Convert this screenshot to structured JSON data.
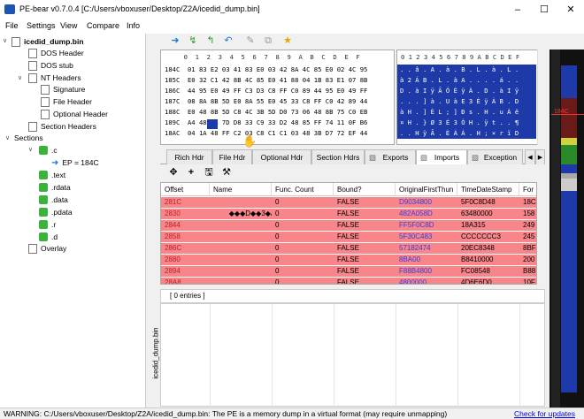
{
  "window": {
    "title": "PE-bear v0.7.0.4 [C:/Users/vboxuser/Desktop/Z2A/icedid_dump.bin]"
  },
  "menu": [
    "File",
    "Settings",
    "View",
    "Compare",
    "Info"
  ],
  "tree": {
    "root": "icedid_dump.bin",
    "dos_header": "DOS Header",
    "dos_stub": "DOS stub",
    "nt_headers": "NT Headers",
    "signature": "Signature",
    "file_header": "File Header",
    "optional_header": "Optional Header",
    "section_headers": "Section Headers",
    "sections": "Sections",
    "sec_c": ".c",
    "ep": "EP = 184C",
    "sec_text": ".text",
    "sec_rdata": ".rdata",
    "sec_data": ".data",
    "sec_pdata": ".pdata",
    "sec_r": ".r",
    "sec_d": ".d",
    "overlay": "Overlay"
  },
  "hex": {
    "header": "     0  1  2  3  4  5  6  7  8  9  A  B  C  D  E  F",
    "rows": [
      "184C  01 83 E2 03 41 83 E0 03 42 8A 4C 85 E0 02 4C 95",
      "185C  E0 32 C1 42 8B 4C 85 E0 41 88 04 1B 83 E1 07 8B",
      "186C  44 95 E0 49 FF C3 D3 C8 FF C0 89 44 95 E0 49 FF",
      "187C  08 8A 8B 5D E0 8A 55 E0 45 33 C8 FF C0 42 89 44",
      "188C  E0 48 8B 5D C8 4C 3B 5D D0 73 06 48 8B 75 C0 EB",
      "189C  A4 48 8B 7D D8 33 C9 33 D2 48 85 FF 74 11 0F B6",
      "18AC  04 1A 48 FF C2 03 C8 C1 C1 03 48 3B D7 72 EF 44"
    ],
    "ascii_header": "0 1 2 3 4 5 6 7 8 9 A B C D E F",
    "ascii_rows": [
      ". . â . A . à . B . L . à . L .",
      "à 2 Á B . L . à A . . . . á . .",
      "D . à I ÿ Ã Ó È ÿ À . D . à I ÿ",
      ". . . ] à . U à E 3 È ÿ À B . D",
      "à H . ] È L ; ] Ð s . H . u À ë",
      "¤ H . } Ø 3 É 3 Ò H . ÿ t . . ¶",
      ". . H ÿ Â . È Á Á . H ; × r ï D"
    ]
  },
  "minimap_label": "184C",
  "tabs": [
    "Rich Hdr",
    "File Hdr",
    "Optional Hdr",
    "Section Hdrs",
    "Exports",
    "Imports",
    "Exception"
  ],
  "active_tab": "Imports",
  "imports": {
    "columns": [
      "Offset",
      "Name",
      "Func. Count",
      "Bound?",
      "OriginalFirstThun",
      "TimeDateStamp",
      "For"
    ],
    "rows": [
      [
        "281C",
        "",
        "0",
        "FALSE",
        "D9034800",
        "5F0C8D48",
        "18C"
      ],
      [
        "2830",
        "        ◆◆◆D◆◆3◆A...",
        "0",
        "FALSE",
        "482A058D",
        "63480000",
        "158"
      ],
      [
        "2844",
        "",
        "0",
        "FALSE",
        "FF5F0C8D",
        "18A315",
        "249"
      ],
      [
        "2858",
        "",
        "0",
        "FALSE",
        "5F30C483",
        "CCCCCCC3",
        "245"
      ],
      [
        "286C",
        "",
        "0",
        "FALSE",
        "57182474",
        "20EC8348",
        "8BF"
      ],
      [
        "2880",
        "",
        "0",
        "FALSE",
        "8BA00",
        "B8410000",
        "200"
      ],
      [
        "2894",
        "",
        "0",
        "FALSE",
        "F88B4800",
        "FC08548",
        "B88"
      ],
      [
        "28A8",
        "",
        "0",
        "FALSE",
        "4800000",
        "4D6E6D0",
        "10F"
      ]
    ]
  },
  "entries_label": "[ 0 entries ]",
  "side_label": "icedid_dump.bin",
  "status": {
    "text": "WARNING: C:/Users/vboxuser/Desktop/Z2A/icedid_dump.bin: The PE is a memory dump in a virtual format (may require unmapping)",
    "link": "Check for updates"
  },
  "colors": {
    "import_row": "#f7858a",
    "hex_select": "#1e3aa8",
    "link": "#0000ee"
  }
}
